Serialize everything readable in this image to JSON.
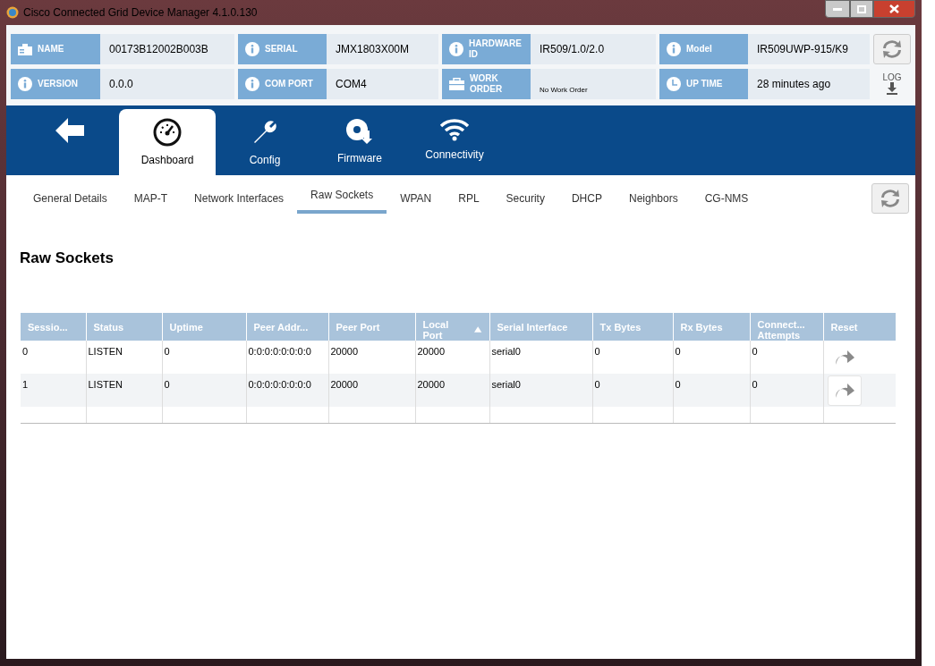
{
  "window": {
    "title": "Cisco Connected Grid Device Manager 4.1.0.130"
  },
  "info": [
    [
      {
        "label": "NAME",
        "value": "00173B12002B003B"
      },
      {
        "label": "SERIAL",
        "value": "JMX1803X00M"
      },
      {
        "label": "HARDWARE ID",
        "value": "IR509/1.0/2.0"
      },
      {
        "label": "Model",
        "value": "IR509UWP-915/K9"
      }
    ],
    [
      {
        "label": "VERSION",
        "value": "0.0.0"
      },
      {
        "label": "COM PORT",
        "value": "COM4"
      },
      {
        "label": "WORK ORDER",
        "value": "No Work Order"
      },
      {
        "label": "UP TIME",
        "value": "28 minutes ago"
      }
    ]
  ],
  "log_button": {
    "label": "LOG"
  },
  "nav_tabs": [
    {
      "kind": "back",
      "selected": false
    },
    {
      "kind": "dashboard",
      "label": "Dashboard",
      "selected": true
    },
    {
      "kind": "config",
      "label": "Config",
      "selected": false
    },
    {
      "kind": "firmware",
      "label": "Firmware",
      "selected": false
    },
    {
      "kind": "connectivity",
      "label": "Connectivity",
      "selected": false
    }
  ],
  "sub_tabs": [
    {
      "label": "General Details",
      "selected": false
    },
    {
      "label": "MAP-T",
      "selected": false
    },
    {
      "label": "Network Interfaces",
      "selected": false
    },
    {
      "label": "Raw Sockets",
      "selected": true
    },
    {
      "label": "WPAN",
      "selected": false
    },
    {
      "label": "RPL",
      "selected": false
    },
    {
      "label": "Security",
      "selected": false
    },
    {
      "label": "DHCP",
      "selected": false
    },
    {
      "label": "Neighbors",
      "selected": false
    },
    {
      "label": "CG-NMS",
      "selected": false
    }
  ],
  "heading": "Raw Sockets",
  "table": {
    "columns": [
      {
        "label": "Sessio...",
        "sorted": false
      },
      {
        "label": "Status",
        "sorted": false
      },
      {
        "label": "Uptime",
        "sorted": false
      },
      {
        "label": "Peer Addr...",
        "sorted": false
      },
      {
        "label": "Peer Port",
        "sorted": false
      },
      {
        "label": "Local Port",
        "sorted": true
      },
      {
        "label": "Serial Interface",
        "sorted": false
      },
      {
        "label": "Tx Bytes",
        "sorted": false
      },
      {
        "label": "Rx Bytes",
        "sorted": false
      },
      {
        "label": "Connect... Attempts",
        "sorted": false
      },
      {
        "label": "Reset",
        "sorted": false
      }
    ],
    "rows": [
      {
        "cells": [
          "0",
          "LISTEN",
          "0",
          "0:0:0:0:0:0:0:0",
          "20000",
          "20000",
          "serial0",
          "0",
          "0",
          "0"
        ],
        "reset_hovered": false
      },
      {
        "cells": [
          "1",
          "LISTEN",
          "0",
          "0:0:0:0:0:0:0:0",
          "20000",
          "20000",
          "serial0",
          "0",
          "0",
          "0"
        ],
        "reset_hovered": true
      }
    ]
  }
}
